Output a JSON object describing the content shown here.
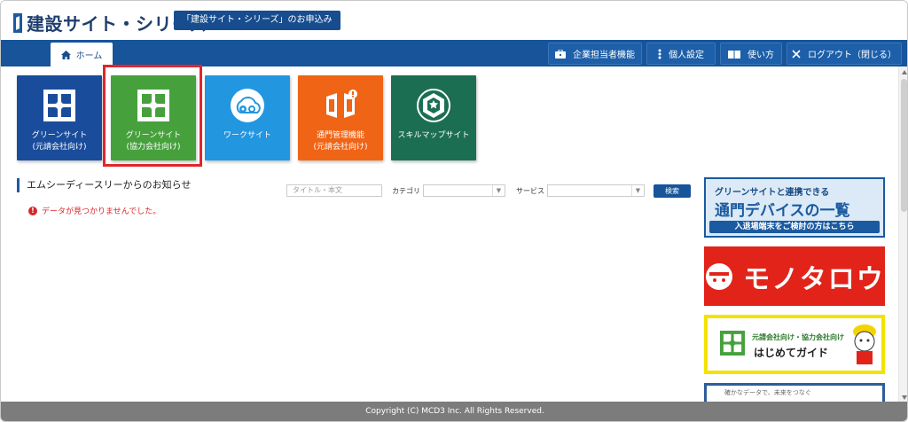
{
  "header": {
    "logo_text": "建設サイト・シリーズ",
    "apply_button": "「建設サイト・シリーズ」のお申込み"
  },
  "nav": {
    "home": "ホーム",
    "buttons": [
      {
        "label": "企業担当者機能",
        "icon": "briefcase-icon"
      },
      {
        "label": "個人設定",
        "icon": "kebab-icon"
      },
      {
        "label": "使い方",
        "icon": "book-icon"
      },
      {
        "label": "ログアウト（閉じる）",
        "icon": "close-icon"
      }
    ]
  },
  "tiles": [
    {
      "label": "グリーンサイト\n(元請会社向け)",
      "color": "#1a4c9c",
      "icon": "green-site-icon"
    },
    {
      "label": "グリーンサイト\n(協力会社向け)",
      "color": "#46a13d",
      "icon": "green-site-icon"
    },
    {
      "label": "ワークサイト",
      "color": "#2396e0",
      "icon": "work-site-icon"
    },
    {
      "label": "通門管理機能\n(元請会社向け)",
      "color": "#f06416",
      "icon": "gate-icon"
    },
    {
      "label": "スキルマップサイト",
      "color": "#1b6e52",
      "icon": "skill-map-icon"
    }
  ],
  "notices": {
    "title": "エムシーディースリーからのお知らせ",
    "error": "データが見つかりませんでした。",
    "search_placeholder": "タイトル・本文",
    "category_label": "カテゴリ",
    "service_label": "サービス",
    "search_button": "検索"
  },
  "banners": {
    "b1_line1": "グリーンサイトと連携できる",
    "b1_line2": "通門デバイスの一覧",
    "b1_line3": "入退場端末をご検討の方はこちら",
    "b2_text": "モノタロウ",
    "b3_line1": "元請会社向け・協力会社向け",
    "b3_line2": "はじめてガイド",
    "b4_text": "確かなデータで、未来をつなぐ"
  },
  "footer": "Copyright (C) MCD3 Inc. All Rights Reserved.",
  "colors": {
    "primary": "#17549a",
    "highlight": "#e0262c",
    "error": "#d9252b"
  }
}
